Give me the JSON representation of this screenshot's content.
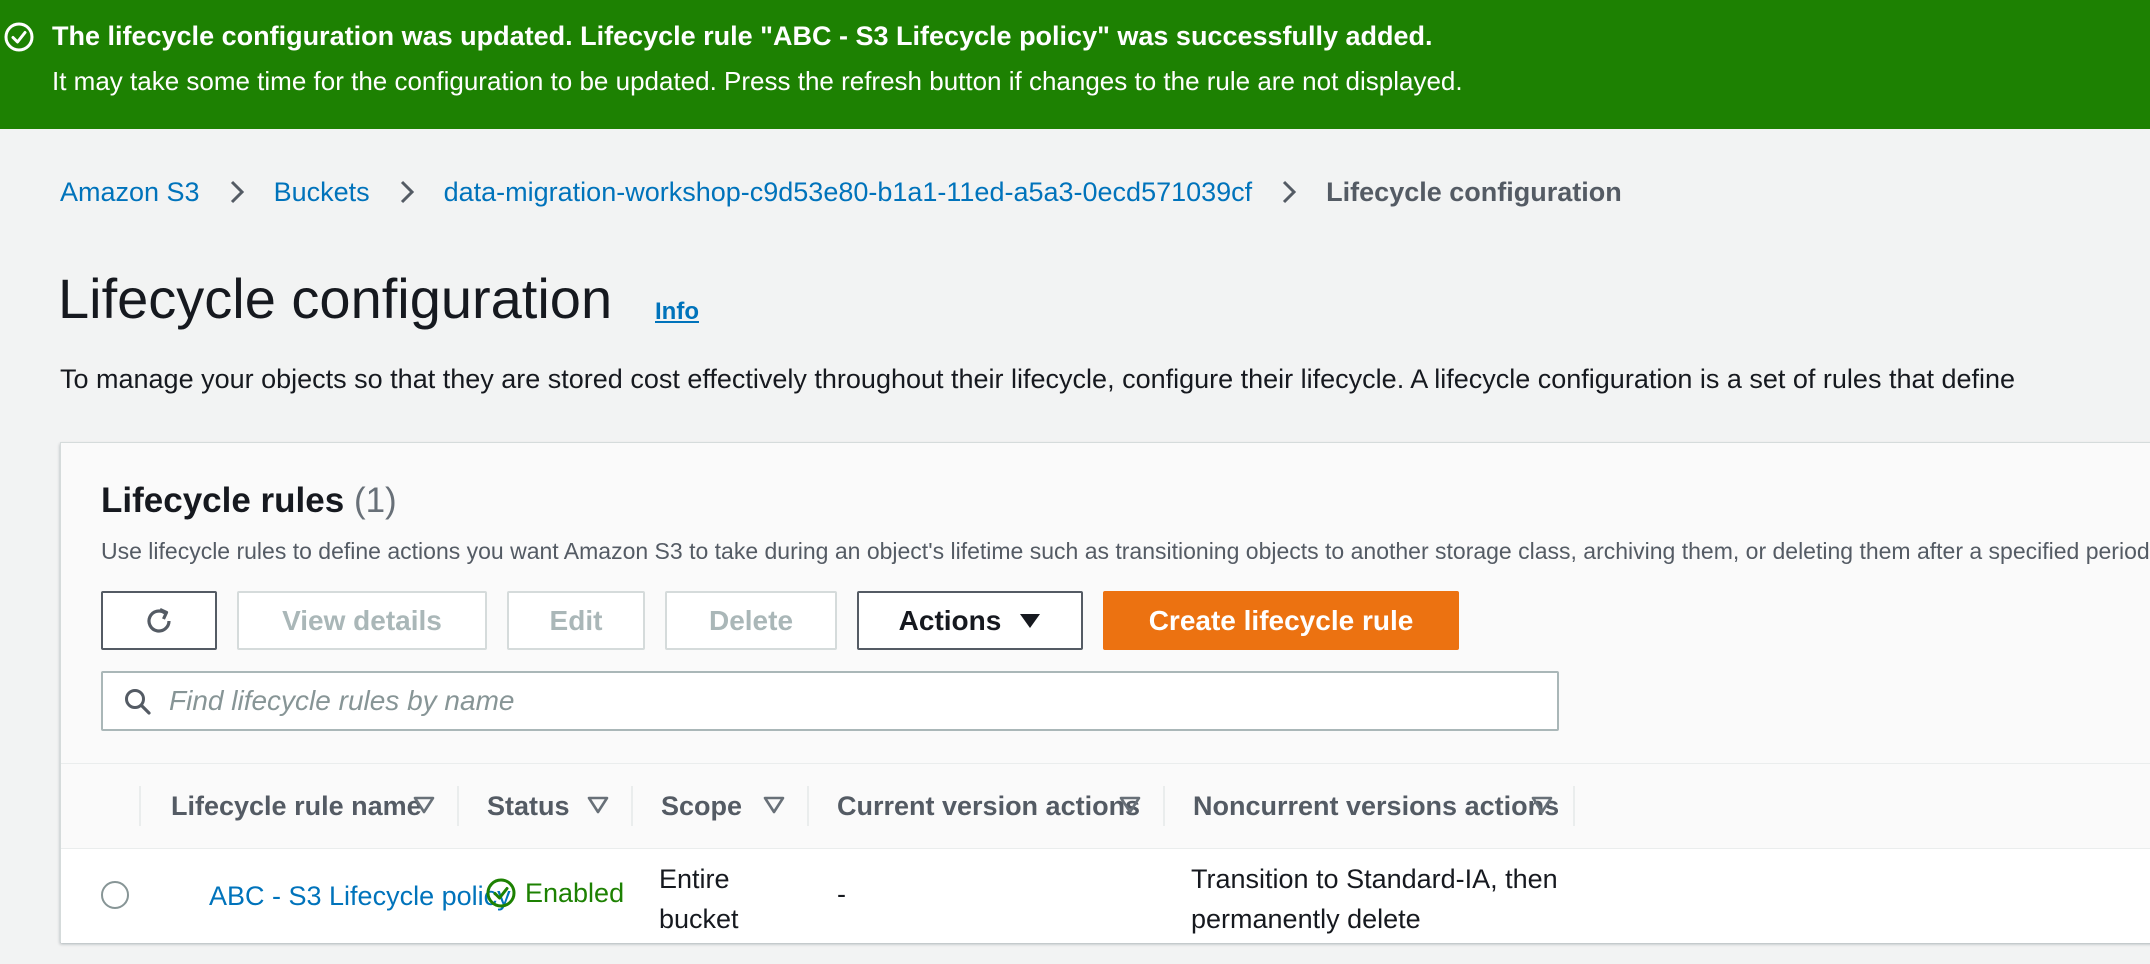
{
  "flash": {
    "title": "The lifecycle configuration was updated. Lifecycle rule \"ABC - S3 Lifecycle policy\" was successfully added.",
    "message": "It may take some time for the configuration to be updated. Press the refresh button if changes to the rule are not displayed.",
    "color": "#1d8102"
  },
  "breadcrumb": {
    "items": [
      "Amazon S3",
      "Buckets",
      "data-migration-workshop-c9d53e80-b1a1-11ed-a5a3-0ecd571039cf"
    ],
    "current": "Lifecycle configuration"
  },
  "page": {
    "title": "Lifecycle configuration",
    "info": "Info",
    "description": "To manage your objects so that they are stored cost effectively throughout their lifecycle, configure their lifecycle. A lifecycle configuration is a set of rules that define"
  },
  "rules": {
    "title": "Lifecycle rules",
    "count": "(1)",
    "description": "Use lifecycle rules to define actions you want Amazon S3 to take during an object's lifetime such as transitioning objects to another storage class, archiving them, or deleting them after a specified period of time.",
    "buttons": {
      "view_details": "View details",
      "edit": "Edit",
      "delete": "Delete",
      "actions": "Actions",
      "create": "Create lifecycle rule"
    },
    "search_placeholder": "Find lifecycle rules by name",
    "columns": [
      "Lifecycle rule name",
      "Status",
      "Scope",
      "Current version actions",
      "Noncurrent versions actions"
    ],
    "rows": [
      {
        "name": "ABC - S3 Lifecycle policy",
        "status": "Enabled",
        "scope_line1": "Entire",
        "scope_line2": "bucket",
        "current_actions": "-",
        "noncurrent_line1": "Transition to Standard-IA, then",
        "noncurrent_line2": "permanently delete"
      }
    ]
  },
  "icons": {
    "flash_status": "check-circle-icon",
    "breadcrumb_separator": "chevron-right-icon",
    "refresh": "refresh-icon",
    "dropdown": "caret-down-icon",
    "search": "search-icon",
    "sort": "sort-down-icon",
    "status": "check-circle-icon"
  },
  "colors": {
    "primary_button": "#ec7211",
    "link": "#0073bb",
    "success": "#1d8102"
  }
}
